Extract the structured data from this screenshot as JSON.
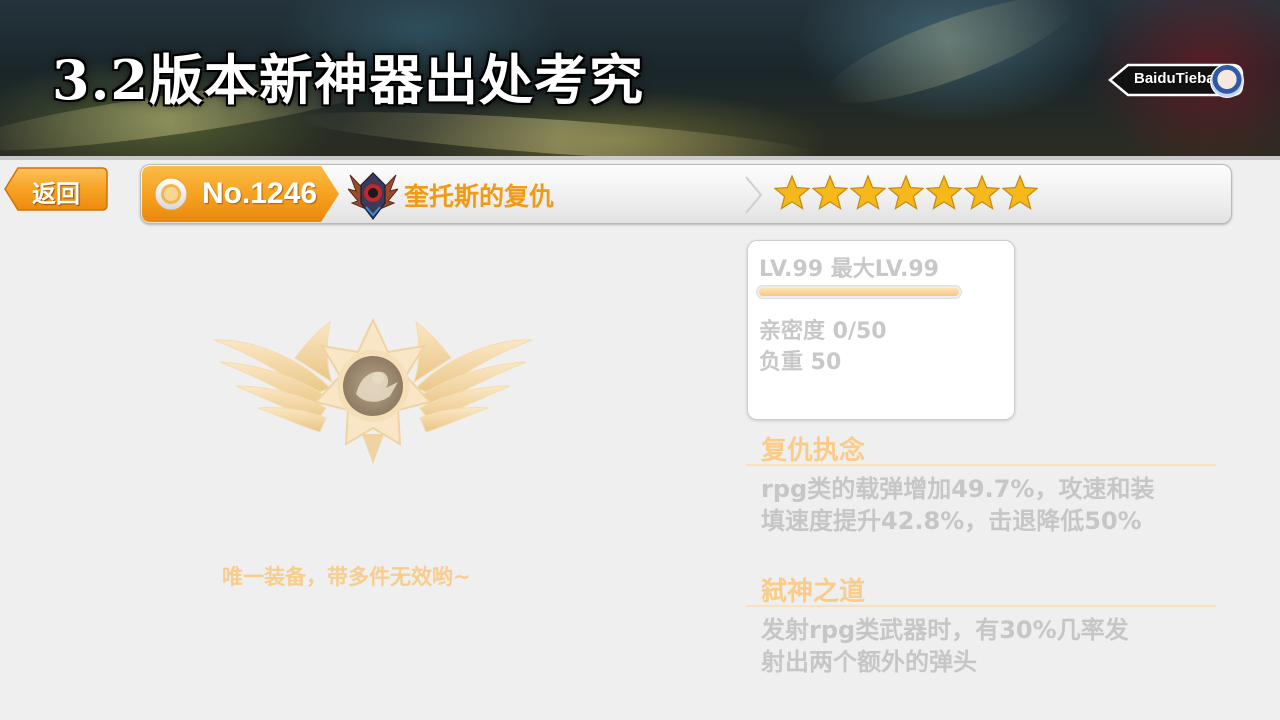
{
  "header": {
    "title": "3.2版本新神器出处考究",
    "watermark": "BaiduTieba"
  },
  "nav": {
    "back_label": "返回"
  },
  "item": {
    "number": "No.1246",
    "name": "奎托斯的复仇",
    "stars": 7,
    "stars_max": 7,
    "icon": "winged-skull-emblem-icon"
  },
  "stats": {
    "level_text": "LV.99 最大LV.99",
    "exp_progress": 1.0,
    "affinity_text": "亲密度 0/50",
    "weight_text": "负重 50"
  },
  "note": "唯一装备，带多件无效哟~",
  "skills": [
    {
      "title": "复仇执念",
      "lines": [
        "rpg类的载弹增加49.7%，攻速和装",
        "填速度提升42.8%，击退降低50%"
      ]
    },
    {
      "title": "弑神之道",
      "lines": [
        "发射rpg类武器时，有30%几率发",
        "射出两个额外的弹头"
      ]
    }
  ],
  "colors": {
    "accent_orange": "#f29a12",
    "star_gold": "#f6b91c",
    "skill_title": "#f9cc8a",
    "muted_text": "#c8c8c8"
  }
}
